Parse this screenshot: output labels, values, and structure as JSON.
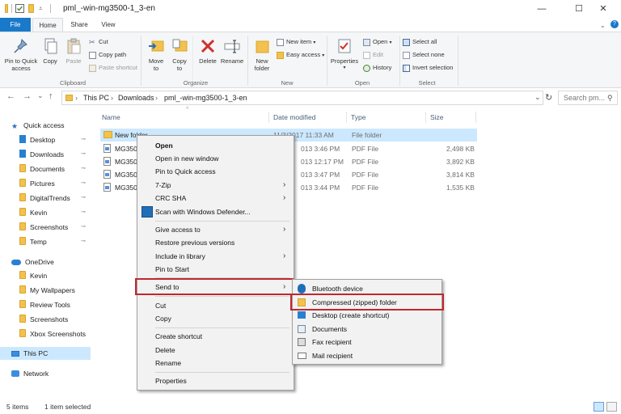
{
  "window": {
    "title": "pml_-win-mg3500-1_3-en",
    "controls": {
      "minimize": "—",
      "maximize": "☐",
      "close": "✕"
    }
  },
  "ribbon": {
    "tabs": [
      "File",
      "Home",
      "Share",
      "View"
    ],
    "help_glyph": "?",
    "clipboard": {
      "pin_quick_access": [
        "Pin to Quick",
        "access"
      ],
      "copy": "Copy",
      "paste": "Paste",
      "cut": "Cut",
      "copy_path": "Copy path",
      "paste_shortcut": "Paste shortcut",
      "group": "Clipboard"
    },
    "organize": {
      "move_to": [
        "Move",
        "to"
      ],
      "copy_to": [
        "Copy",
        "to"
      ],
      "delete": "Delete",
      "rename": "Rename",
      "group": "Organize"
    },
    "new": {
      "new_folder": [
        "New",
        "folder"
      ],
      "new_item": "New item",
      "easy_access": "Easy access",
      "group": "New"
    },
    "open": {
      "properties": "Properties",
      "open": "Open",
      "edit": "Edit",
      "history": "History",
      "group": "Open"
    },
    "select": {
      "select_all": "Select all",
      "select_none": "Select none",
      "invert_selection": "Invert selection",
      "group": "Select"
    }
  },
  "address": {
    "back": "←",
    "forward": "→",
    "dropdown": "⌄",
    "up": "↑",
    "breadcrumbs": [
      "This PC",
      "Downloads",
      "pml_-win-mg3500-1_3-en"
    ],
    "separator": "›",
    "refresh": "↻",
    "search_placeholder": "Search pm..."
  },
  "nav": {
    "quick_access": "Quick access",
    "quick_items": [
      "Desktop",
      "Downloads",
      "Documents",
      "Pictures",
      "DigitalTrends",
      "Kevin",
      "Screenshots",
      "Temp"
    ],
    "onedrive": "OneDrive",
    "onedrive_items": [
      "Kevin",
      "My Wallpapers",
      "Review Tools",
      "Screenshots",
      "Xbox Screenshots"
    ],
    "this_pc": "This PC",
    "network": "Network",
    "pin_glyph": "📌"
  },
  "files": {
    "columns": [
      "Name",
      "Date modified",
      "Type",
      "Size"
    ],
    "sort_caret": "^",
    "rows": [
      {
        "name": "New folder",
        "date": "11/3/2017 11:33 AM",
        "type": "File folder",
        "size": ""
      },
      {
        "name": "MG350",
        "date": "013 3:46 PM",
        "type": "PDF File",
        "size": "2,498 KB"
      },
      {
        "name": "MG350",
        "date": "013 12:17 PM",
        "type": "PDF File",
        "size": "3,892 KB"
      },
      {
        "name": "MG350",
        "date": "013 3:47 PM",
        "type": "PDF File",
        "size": "3,814 KB"
      },
      {
        "name": "MG350",
        "date": "013 3:44 PM",
        "type": "PDF File",
        "size": "1,535 KB"
      }
    ]
  },
  "context_menu": {
    "items": [
      "Open",
      "Open in new window",
      "Pin to Quick access",
      "7-Zip",
      "CRC SHA",
      "Scan with Windows Defender...",
      "Give access to",
      "Restore previous versions",
      "Include in library",
      "Pin to Start",
      "Send to",
      "Cut",
      "Copy",
      "Create shortcut",
      "Delete",
      "Rename",
      "Properties"
    ],
    "chevron": "›"
  },
  "send_to_menu": {
    "items": [
      "Bluetooth device",
      "Compressed (zipped) folder",
      "Desktop (create shortcut)",
      "Documents",
      "Fax recipient",
      "Mail recipient"
    ]
  },
  "status": {
    "item_count": "5 items",
    "selected": "1 item selected"
  },
  "colors": {
    "accent": "#1979ca",
    "selection": "#cce8ff",
    "highlight_box": "#c1272d",
    "folder": "#f2c14e"
  }
}
